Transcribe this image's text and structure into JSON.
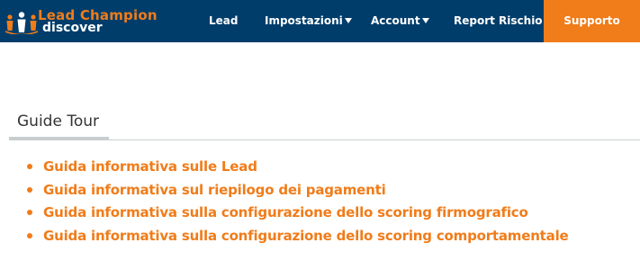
{
  "colors": {
    "navbar_bg": "#003d6b",
    "accent": "#f07c1a",
    "nav_text": "#ffffff",
    "section_title": "#333333",
    "rule": "#c9cdd0"
  },
  "logo": {
    "title": "Lead Champion",
    "subtitle": "discover",
    "icon": "people-crown-icon"
  },
  "nav": {
    "lead": "Lead",
    "impostazioni": "Impostazioni",
    "account": "Account",
    "report_rischio": "Report Rischio",
    "supporto": "Supporto"
  },
  "section": {
    "title": "Guide Tour"
  },
  "guides": [
    "Guida informativa sulle Lead",
    "Guida informativa sul riepilogo dei pagamenti",
    "Guida informativa sulla configurazione dello scoring firmografico",
    "Guida informativa sulla configurazione dello scoring comportamentale"
  ]
}
